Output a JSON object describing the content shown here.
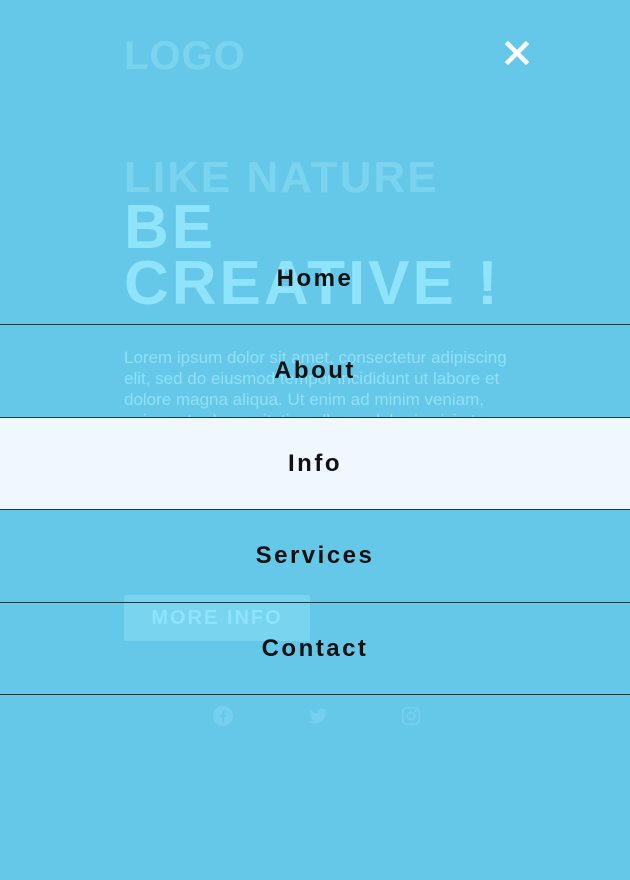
{
  "logo": "LOGO",
  "hero": {
    "kicker": "LIKE NATURE",
    "title_line1": "BE",
    "title_line2": "CREATIVE !",
    "body": "Lorem ipsum dolor sit amet, consectetur adipiscing elit, sed do eiusmod tempor incididunt ut labore et dolore magna aliqua. Ut enim ad minim veniam, quis nostrud exercitation ullamco laboris nisi ut aliquip ex ea commodo consequat. Excepteur sint occaecat cupidatat non proident, sunt in culpa qui officia deserunt mollit anim id est laborum."
  },
  "cta": {
    "label": "MORE INFO"
  },
  "social": {
    "icons": [
      "facebook-icon",
      "twitter-icon",
      "instagram-icon"
    ]
  },
  "nav": {
    "close_icon": "close-icon",
    "active_index": 2,
    "items": [
      {
        "label": "Home"
      },
      {
        "label": "About"
      },
      {
        "label": "Info"
      },
      {
        "label": "Services"
      },
      {
        "label": "Contact"
      }
    ]
  },
  "colors": {
    "background": "#66c8e8",
    "active_item_bg": "#f0f7ff",
    "nav_text": "#111111",
    "faded_text": "#8fe3fb"
  }
}
